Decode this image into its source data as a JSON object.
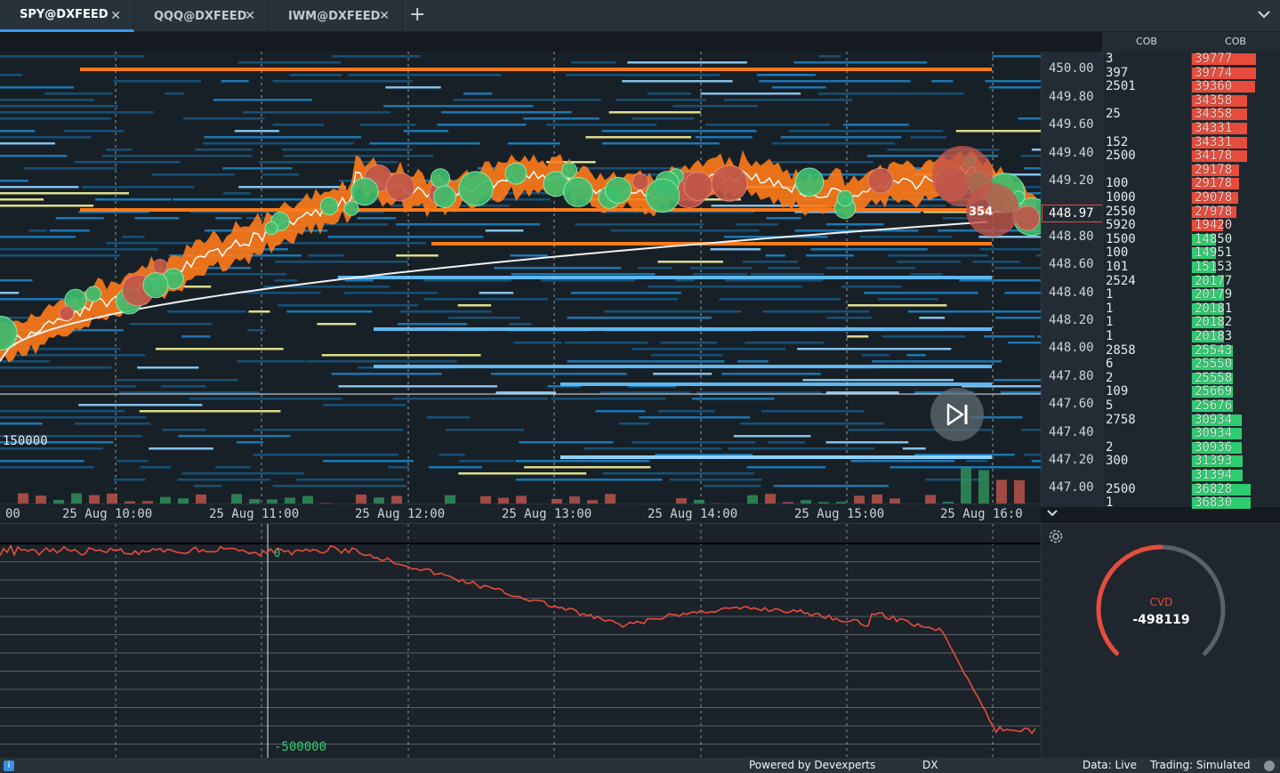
{
  "tabs": [
    {
      "label": "SPY@DXFEED",
      "active": true
    },
    {
      "label": "QQQ@DXFEED",
      "active": false
    },
    {
      "label": "IWM@DXFEED",
      "active": false
    }
  ],
  "icons": {
    "close": "close-icon",
    "add": "plus-icon",
    "menu": "chevron-down-icon",
    "replay": "skip-forward-icon",
    "settings": "gear-icon",
    "info": "info-icon"
  },
  "add_tab_symbol": "+",
  "price_axis": {
    "labels": [
      "450.00",
      "449.80",
      "449.60",
      "449.40",
      "449.20",
      "448.97",
      "448.80",
      "448.60",
      "448.40",
      "448.20",
      "448.00",
      "447.80",
      "447.60",
      "447.40",
      "447.20",
      "447.00"
    ],
    "current_price": "448.97"
  },
  "heatmap": {
    "volume_label": "150000",
    "trade_bubble_label": "354",
    "time_labels": [
      "00",
      "25 Aug 10:00",
      "25 Aug 11:00",
      "25 Aug 12:00",
      "25 Aug 13:00",
      "25 Aug 14:00",
      "25 Aug 15:00",
      "25 Aug 16:0"
    ]
  },
  "cob": {
    "left_title": "COB",
    "right_title": "COB",
    "left_values": [
      "3",
      "397",
      "2501",
      "",
      "25",
      "",
      "152",
      "2500",
      "",
      "100",
      "1000",
      "2550",
      "5920",
      "1500",
      "100",
      "101",
      "2524",
      "1",
      "1",
      "1",
      "1",
      "2858",
      "6",
      "2",
      "109",
      "5",
      "2758",
      "",
      "2",
      "300",
      "",
      "2500",
      "1"
    ],
    "right_ask": [
      "39777",
      "39774",
      "39360",
      "34358",
      "34358",
      "34331",
      "34331",
      "34178",
      "29178",
      "29178",
      "29078",
      "27978",
      "19420"
    ],
    "right_bid": [
      "14850",
      "14951",
      "15153",
      "20177",
      "20179",
      "20181",
      "20182",
      "20183",
      "25543",
      "25550",
      "25558",
      "25669",
      "25676",
      "30934",
      "30934",
      "30936",
      "31393",
      "31394",
      "36828",
      "36830"
    ]
  },
  "cvd": {
    "top_label": "0",
    "bottom_label": "-500000",
    "gauge_label": "CVD",
    "gauge_value": "-498119",
    "gauge_fraction": 0.5,
    "colors": {
      "line": "#e74c3c",
      "gauge_fill": "#e74c3c",
      "gauge_track": "#56636d"
    }
  },
  "statusbar": {
    "powered_by": "Powered by Devexperts",
    "dx": "DX",
    "data": "Data: Live",
    "trading": "Trading: Simulated",
    "info_symbol": "i"
  },
  "colors": {
    "accent": "#2f9bff",
    "ask": "#e74c3c",
    "bid": "#2ecc71",
    "price_band": "#ff7a1a"
  }
}
